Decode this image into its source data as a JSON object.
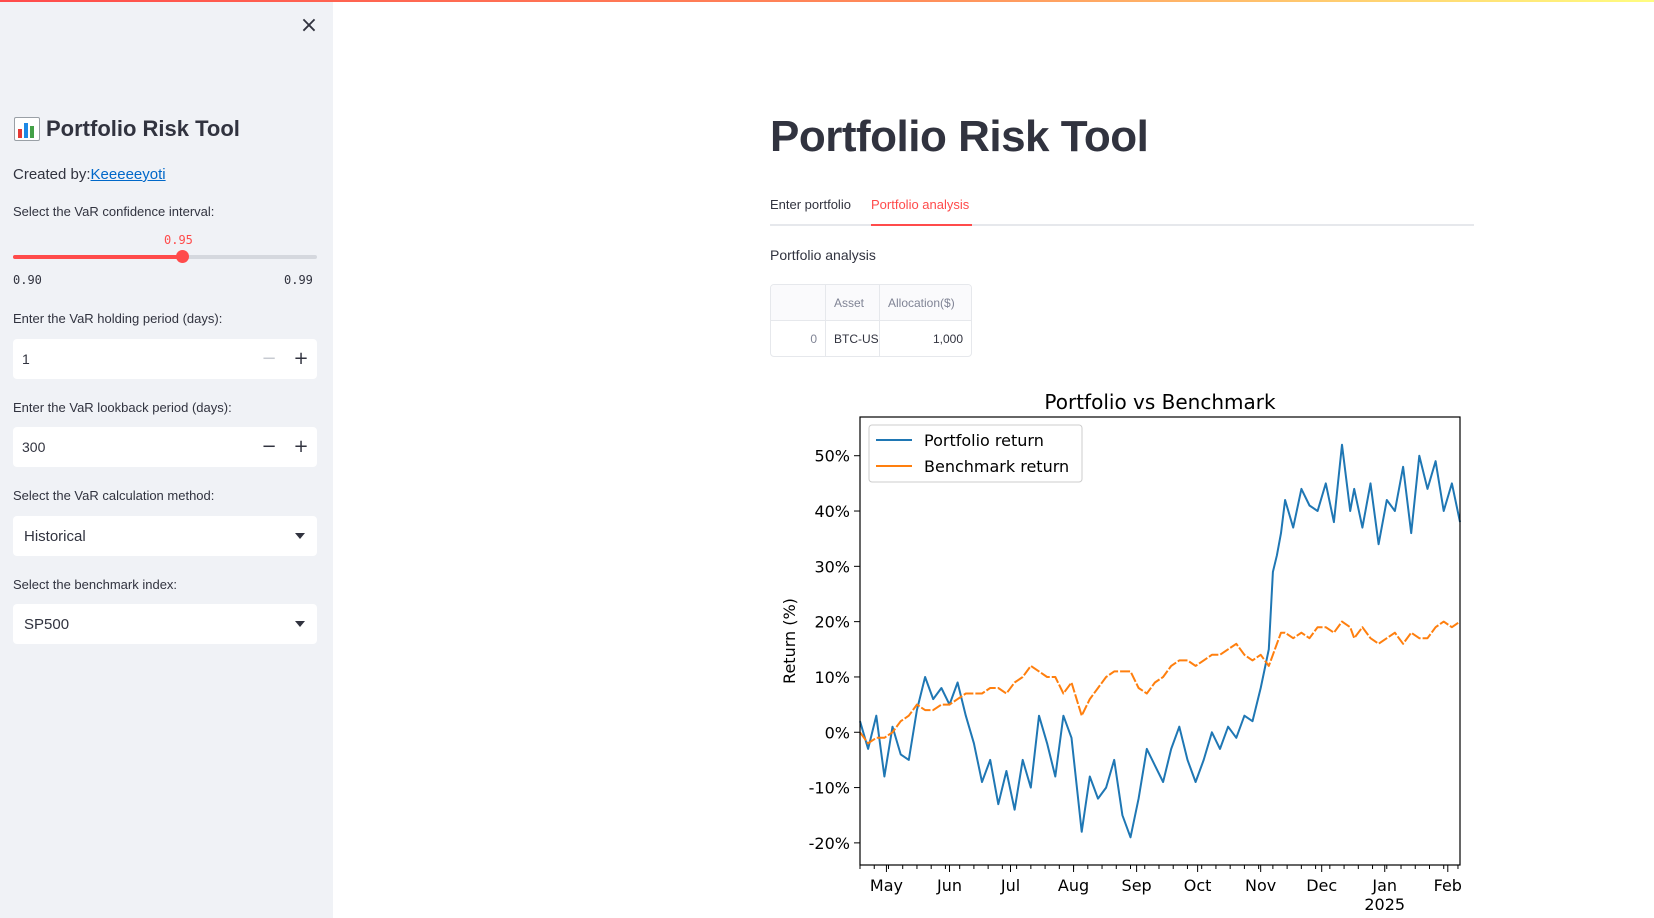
{
  "sidebar": {
    "close_glyph": "×",
    "title": "Portfolio Risk Tool",
    "created_prefix": "Created by:",
    "created_link": "Keeeeeyoti",
    "confidence": {
      "label": "Select the VaR confidence interval:",
      "value": "0.95",
      "min": "0.90",
      "max": "0.99",
      "fraction": 0.555
    },
    "holding": {
      "label": "Enter the VaR holding period (days):",
      "value": "1"
    },
    "lookback": {
      "label": "Enter the VaR lookback period (days):",
      "value": "300"
    },
    "method": {
      "label": "Select the VaR calculation method:",
      "value": "Historical"
    },
    "benchmark": {
      "label": "Select the benchmark index:",
      "value": "SP500"
    }
  },
  "main": {
    "title": "Portfolio Risk Tool",
    "tabs": [
      {
        "label": "Enter portfolio"
      },
      {
        "label": "Portfolio analysis"
      }
    ],
    "active_tab": 1,
    "section_label": "Portfolio analysis",
    "table": {
      "columns": [
        "",
        "Asset",
        "Allocation($)"
      ],
      "rows": [
        {
          "index": "0",
          "asset": "BTC-USD",
          "allocation": "1,000"
        }
      ]
    }
  },
  "colors": {
    "accent": "#ff4b4b",
    "link": "#0068c9",
    "portfolio": "#1f77b4",
    "benchmark": "#ff7f0e"
  },
  "chart_data": {
    "type": "line",
    "title": "Portfolio vs Benchmark",
    "xlabel": "",
    "ylabel": "Return (%)",
    "ylim": [
      -0.24,
      0.57
    ],
    "yticks": [
      -0.2,
      -0.1,
      0,
      0.1,
      0.2,
      0.3,
      0.4,
      0.5
    ],
    "ytick_labels": [
      "-20%",
      "-10%",
      "0%",
      "10%",
      "20%",
      "30%",
      "40%",
      "50%"
    ],
    "xlim": [
      "2024-04-18",
      "2025-02-07"
    ],
    "xticks": [
      "2024-05-01",
      "2024-06-01",
      "2024-07-01",
      "2024-08-01",
      "2024-09-01",
      "2024-10-01",
      "2024-11-01",
      "2024-12-01",
      "2025-01-01",
      "2025-02-01"
    ],
    "xtick_labels": [
      "May",
      "Jun",
      "Jul",
      "Aug",
      "Sep",
      "Oct",
      "Nov",
      "Dec",
      "Jan",
      "Feb"
    ],
    "xtick_sublabel": "2025",
    "legend": "upper-left",
    "grid": false,
    "series": [
      {
        "name": "Portfolio return",
        "x": [
          "2024-04-18",
          "2024-04-22",
          "2024-04-26",
          "2024-04-30",
          "2024-05-04",
          "2024-05-08",
          "2024-05-12",
          "2024-05-16",
          "2024-05-20",
          "2024-05-24",
          "2024-05-28",
          "2024-06-01",
          "2024-06-05",
          "2024-06-09",
          "2024-06-13",
          "2024-06-17",
          "2024-06-21",
          "2024-06-25",
          "2024-06-29",
          "2024-07-03",
          "2024-07-07",
          "2024-07-11",
          "2024-07-15",
          "2024-07-19",
          "2024-07-23",
          "2024-07-27",
          "2024-07-31",
          "2024-08-05",
          "2024-08-09",
          "2024-08-13",
          "2024-08-17",
          "2024-08-21",
          "2024-08-25",
          "2024-08-29",
          "2024-09-02",
          "2024-09-06",
          "2024-09-10",
          "2024-09-14",
          "2024-09-18",
          "2024-09-22",
          "2024-09-26",
          "2024-09-30",
          "2024-10-04",
          "2024-10-08",
          "2024-10-12",
          "2024-10-16",
          "2024-10-20",
          "2024-10-24",
          "2024-10-28",
          "2024-11-01",
          "2024-11-05",
          "2024-11-07",
          "2024-11-09",
          "2024-11-11",
          "2024-11-13",
          "2024-11-17",
          "2024-11-21",
          "2024-11-25",
          "2024-11-29",
          "2024-12-03",
          "2024-12-07",
          "2024-12-11",
          "2024-12-15",
          "2024-12-17",
          "2024-12-21",
          "2024-12-25",
          "2024-12-29",
          "2025-01-02",
          "2025-01-06",
          "2025-01-10",
          "2025-01-14",
          "2025-01-18",
          "2025-01-22",
          "2025-01-26",
          "2025-01-30",
          "2025-02-03",
          "2025-02-07"
        ],
        "values": [
          0.02,
          -0.03,
          0.03,
          -0.08,
          0.01,
          -0.04,
          -0.05,
          0.04,
          0.1,
          0.06,
          0.08,
          0.05,
          0.09,
          0.03,
          -0.02,
          -0.09,
          -0.05,
          -0.13,
          -0.07,
          -0.14,
          -0.05,
          -0.1,
          0.03,
          -0.02,
          -0.08,
          0.03,
          -0.01,
          -0.18,
          -0.08,
          -0.12,
          -0.1,
          -0.05,
          -0.15,
          -0.19,
          -0.12,
          -0.03,
          -0.06,
          -0.09,
          -0.03,
          0.01,
          -0.05,
          -0.09,
          -0.05,
          0.0,
          -0.03,
          0.01,
          -0.01,
          0.03,
          0.02,
          0.08,
          0.15,
          0.29,
          0.32,
          0.36,
          0.42,
          0.37,
          0.44,
          0.41,
          0.4,
          0.45,
          0.38,
          0.52,
          0.4,
          0.44,
          0.37,
          0.45,
          0.34,
          0.42,
          0.4,
          0.48,
          0.36,
          0.5,
          0.44,
          0.49,
          0.4,
          0.45,
          0.38
        ]
      },
      {
        "name": "Benchmark return",
        "x": [
          "2024-04-18",
          "2024-04-22",
          "2024-04-26",
          "2024-04-30",
          "2024-05-04",
          "2024-05-08",
          "2024-05-12",
          "2024-05-16",
          "2024-05-20",
          "2024-05-24",
          "2024-05-28",
          "2024-06-01",
          "2024-06-05",
          "2024-06-09",
          "2024-06-13",
          "2024-06-17",
          "2024-06-21",
          "2024-06-25",
          "2024-06-29",
          "2024-07-03",
          "2024-07-07",
          "2024-07-11",
          "2024-07-15",
          "2024-07-19",
          "2024-07-23",
          "2024-07-27",
          "2024-07-31",
          "2024-08-05",
          "2024-08-09",
          "2024-08-13",
          "2024-08-17",
          "2024-08-21",
          "2024-08-25",
          "2024-08-29",
          "2024-09-02",
          "2024-09-06",
          "2024-09-10",
          "2024-09-14",
          "2024-09-18",
          "2024-09-22",
          "2024-09-26",
          "2024-09-30",
          "2024-10-04",
          "2024-10-08",
          "2024-10-12",
          "2024-10-16",
          "2024-10-20",
          "2024-10-24",
          "2024-10-28",
          "2024-11-01",
          "2024-11-05",
          "2024-11-07",
          "2024-11-09",
          "2024-11-11",
          "2024-11-13",
          "2024-11-17",
          "2024-11-21",
          "2024-11-25",
          "2024-11-29",
          "2024-12-03",
          "2024-12-07",
          "2024-12-11",
          "2024-12-15",
          "2024-12-17",
          "2024-12-21",
          "2024-12-25",
          "2024-12-29",
          "2025-01-02",
          "2025-01-06",
          "2025-01-10",
          "2025-01-14",
          "2025-01-18",
          "2025-01-22",
          "2025-01-26",
          "2025-01-30",
          "2025-02-03",
          "2025-02-07"
        ],
        "values": [
          0.0,
          -0.02,
          -0.01,
          -0.01,
          0.0,
          0.02,
          0.03,
          0.05,
          0.04,
          0.04,
          0.05,
          0.05,
          0.06,
          0.07,
          0.07,
          0.07,
          0.08,
          0.08,
          0.07,
          0.09,
          0.1,
          0.12,
          0.11,
          0.1,
          0.1,
          0.07,
          0.09,
          0.03,
          0.06,
          0.08,
          0.1,
          0.11,
          0.11,
          0.11,
          0.08,
          0.07,
          0.09,
          0.1,
          0.12,
          0.13,
          0.13,
          0.12,
          0.13,
          0.14,
          0.14,
          0.15,
          0.16,
          0.14,
          0.13,
          0.14,
          0.12,
          0.14,
          0.16,
          0.18,
          0.18,
          0.17,
          0.18,
          0.17,
          0.19,
          0.19,
          0.18,
          0.2,
          0.19,
          0.17,
          0.19,
          0.17,
          0.16,
          0.17,
          0.18,
          0.16,
          0.18,
          0.17,
          0.17,
          0.19,
          0.2,
          0.19,
          0.2
        ]
      }
    ]
  }
}
